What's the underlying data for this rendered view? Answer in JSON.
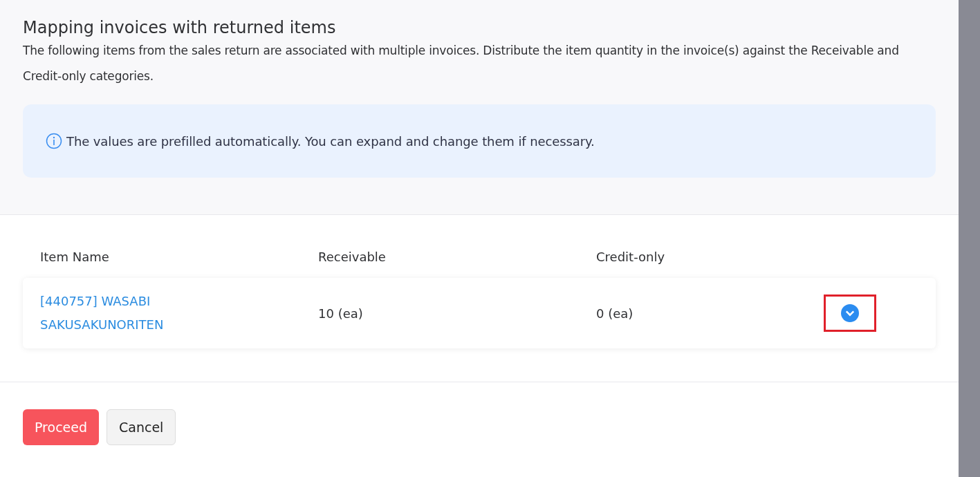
{
  "dialog": {
    "title": "Mapping invoices with returned items",
    "description": "The following items from the sales return are associated with multiple invoices. Distribute the item quantity in the invoice(s) against the Receivable and Credit-only categories.",
    "info": "The values are prefilled automatically. You can expand and change them if necessary."
  },
  "table": {
    "columns": [
      "Item Name",
      "Receivable",
      "Credit-only"
    ],
    "rows": [
      {
        "item_name": "[440757] WASABI SAKUSAKUNORITEN",
        "receivable": "10 (ea)",
        "credit_only": "0 (ea)",
        "expanded": false,
        "highlighted": true
      }
    ]
  },
  "buttons": [
    {
      "label": "Proceed",
      "kind": "primary"
    },
    {
      "label": "Cancel",
      "kind": "secondary"
    }
  ]
}
